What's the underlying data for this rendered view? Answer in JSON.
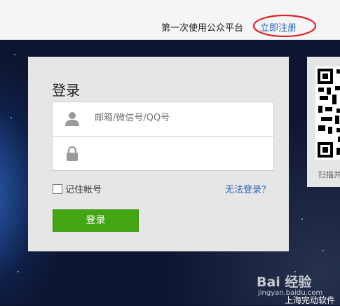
{
  "topbar": {
    "first_time_text": "第一次使用公众平台",
    "register_link": "立即注册"
  },
  "login": {
    "title": "登录",
    "username_placeholder": "邮箱/微信号/QQ号",
    "password_value": "",
    "remember_label": "记住帐号",
    "forgot_link": "无法登录？",
    "submit_label": "登录"
  },
  "qr": {
    "scan_text": "扫描并"
  },
  "watermark": {
    "logo_text": "Bai 经验",
    "url": "jingyan.baidu.com",
    "caption": "上海完动软件"
  },
  "colors": {
    "accent_green": "#44a512",
    "link_blue": "#2a62b8",
    "annotation_red": "#e0202a"
  }
}
